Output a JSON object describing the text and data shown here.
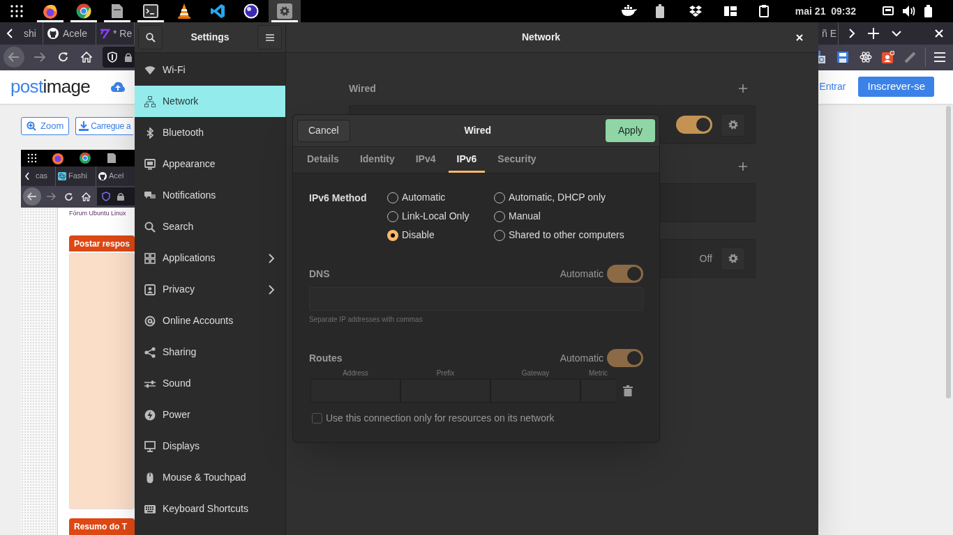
{
  "top_bar": {
    "apps": [
      {
        "kind": "grid",
        "running": false,
        "selected": false
      },
      {
        "kind": "firefox",
        "running": true,
        "selected": false
      },
      {
        "kind": "chrome",
        "running": true,
        "selected": false
      },
      {
        "kind": "files",
        "running": true,
        "selected": false
      },
      {
        "kind": "terminal",
        "running": true,
        "selected": false
      },
      {
        "kind": "vlc",
        "running": false,
        "selected": false
      },
      {
        "kind": "vscode",
        "running": false,
        "selected": false
      },
      {
        "kind": "orb",
        "running": false,
        "selected": false
      },
      {
        "kind": "settings",
        "running": true,
        "selected": true
      }
    ],
    "clock": "mai 21  09:32"
  },
  "browser": {
    "tabs_left": [
      "shi",
      "Acele",
      "* Re"
    ],
    "tabs_right": [
      "ñ E"
    ],
    "site": {
      "logo": [
        "post",
        "image"
      ],
      "login": "Entrar",
      "signup": "Inscrever-se",
      "buttons": [
        "Zoom",
        "Carregue a"
      ]
    },
    "embedded": {
      "tabs": [
        "cas",
        "Fashi",
        "Acel"
      ],
      "forum_link": "Fórum Ubuntu Linux",
      "post_header": "Postar respos",
      "summary_header": "Resumo do T"
    }
  },
  "settings": {
    "title": "Settings",
    "page_title": "Network",
    "sidebar": [
      {
        "kind": "wifi",
        "label": "Wi-Fi",
        "selected": false,
        "arrow": false
      },
      {
        "kind": "network",
        "label": "Network",
        "selected": true,
        "arrow": false
      },
      {
        "kind": "bluetooth",
        "label": "Bluetooth",
        "selected": false,
        "arrow": false
      },
      {
        "kind": "appearance",
        "label": "Appearance",
        "selected": false,
        "arrow": false
      },
      {
        "kind": "notifications",
        "label": "Notifications",
        "selected": false,
        "arrow": false
      },
      {
        "kind": "search",
        "label": "Search",
        "selected": false,
        "arrow": false
      },
      {
        "kind": "applications",
        "label": "Applications",
        "selected": false,
        "arrow": true
      },
      {
        "kind": "privacy",
        "label": "Privacy",
        "selected": false,
        "arrow": true
      },
      {
        "kind": "accounts",
        "label": "Online Accounts",
        "selected": false,
        "arrow": false
      },
      {
        "kind": "sharing",
        "label": "Sharing",
        "selected": false,
        "arrow": false
      },
      {
        "kind": "sound",
        "label": "Sound",
        "selected": false,
        "arrow": false
      },
      {
        "kind": "power",
        "label": "Power",
        "selected": false,
        "arrow": false
      },
      {
        "kind": "displays",
        "label": "Displays",
        "selected": false,
        "arrow": false
      },
      {
        "kind": "mouse",
        "label": "Mouse & Touchpad",
        "selected": false,
        "arrow": false
      },
      {
        "kind": "keyboard",
        "label": "Keyboard Shortcuts",
        "selected": false,
        "arrow": false
      }
    ],
    "network": [
      {
        "kind": "header",
        "label": "Wired"
      },
      {
        "kind": "toggle-card",
        "on": true
      },
      {
        "kind": "header"
      },
      {
        "kind": "empty-card"
      },
      {
        "kind": "status-card",
        "status": "Off"
      }
    ]
  },
  "dialog": {
    "title": "Wired",
    "cancel": "Cancel",
    "apply": "Apply",
    "tabs": [
      {
        "label": "Details",
        "selected": false
      },
      {
        "label": "Identity",
        "selected": false
      },
      {
        "label": "IPv4",
        "selected": false
      },
      {
        "label": "IPv6",
        "selected": true
      },
      {
        "label": "Security",
        "selected": false
      }
    ],
    "method_label": "IPv6 Method",
    "methods": [
      {
        "label": "Automatic",
        "selected": false
      },
      {
        "label": "Automatic, DHCP only",
        "selected": false
      },
      {
        "label": "Link-Local Only",
        "selected": false
      },
      {
        "label": "Manual",
        "selected": false
      },
      {
        "label": "Disable",
        "selected": true
      },
      {
        "label": "Shared to other computers",
        "selected": false
      }
    ],
    "dns": {
      "label": "DNS",
      "auto_label": "Automatic",
      "on": true,
      "hint": "Separate IP addresses with commas"
    },
    "routes": {
      "label": "Routes",
      "auto_label": "Automatic",
      "on": true,
      "columns": [
        "Address",
        "Prefix",
        "Gateway",
        "Metric"
      ]
    },
    "restrict": {
      "label": "Use this connection only for resources on its network",
      "checked": false
    }
  }
}
